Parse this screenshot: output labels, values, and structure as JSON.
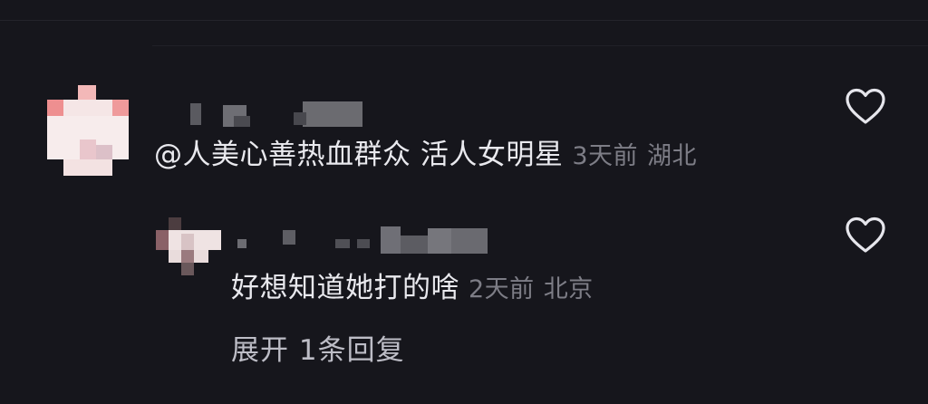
{
  "comments": [
    {
      "text": "@人美心善热血群众 活人女明星",
      "time": "3天前",
      "location": "湖北",
      "avatar_colors": [
        "#f4d8d8",
        "#ee8c8c",
        "#f7eaea",
        "#d8b8c0"
      ]
    }
  ],
  "replies": [
    {
      "text": "好想知道她打的啥",
      "time": "2天前",
      "location": "北京",
      "avatar_colors": [
        "#f1e4e4",
        "#8b6066",
        "#c9aeb0",
        "#5c4a4e"
      ]
    }
  ],
  "expand": {
    "label": "展开 1条回复"
  },
  "icons": {
    "like": "heart-outline-icon"
  },
  "colors": {
    "background": "#16161c",
    "text": "#e9e9ee",
    "meta": "#7d7d86",
    "icon": "#e6e6ec"
  }
}
